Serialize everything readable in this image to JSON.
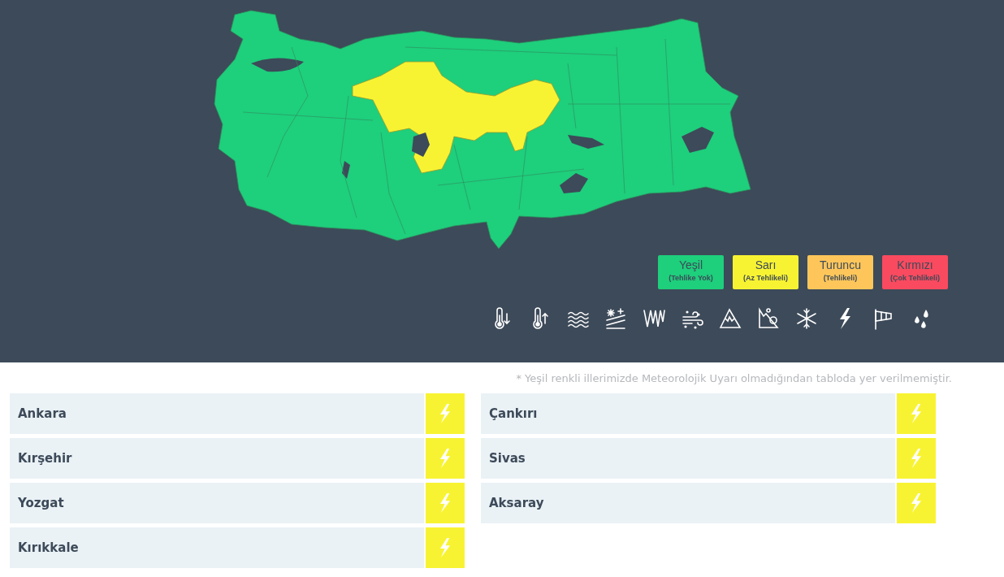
{
  "legend": [
    {
      "label": "Yeşil",
      "sublabel": "(Tehlike Yok)",
      "color": "#1ecf7c"
    },
    {
      "label": "Sarı",
      "sublabel": "(Az Tehlikeli)",
      "color": "#f8f332"
    },
    {
      "label": "Turuncu",
      "sublabel": "(Tehlikeli)",
      "color": "#fec65a"
    },
    {
      "label": "Kırmızı",
      "sublabel": "(Çok Tehlikeli)",
      "color": "#f94a5f"
    }
  ],
  "note": "* Yeşil renkli illerimizde Meteorolojik Uyarı olmadığından tabloda yer verilmemiştir.",
  "warning_columns": [
    [
      {
        "province": "Ankara",
        "kind": "lightning",
        "color": "#f8f332"
      },
      {
        "province": "Kırşehir",
        "kind": "lightning",
        "color": "#f8f332"
      },
      {
        "province": "Yozgat",
        "kind": "lightning",
        "color": "#f8f332"
      },
      {
        "province": "Kırıkkale",
        "kind": "lightning",
        "color": "#f8f332"
      }
    ],
    [
      {
        "province": "Çankırı",
        "kind": "lightning",
        "color": "#f8f332"
      },
      {
        "province": "Sivas",
        "kind": "lightning",
        "color": "#f8f332"
      },
      {
        "province": "Aksaray",
        "kind": "lightning",
        "color": "#f8f332"
      }
    ]
  ]
}
